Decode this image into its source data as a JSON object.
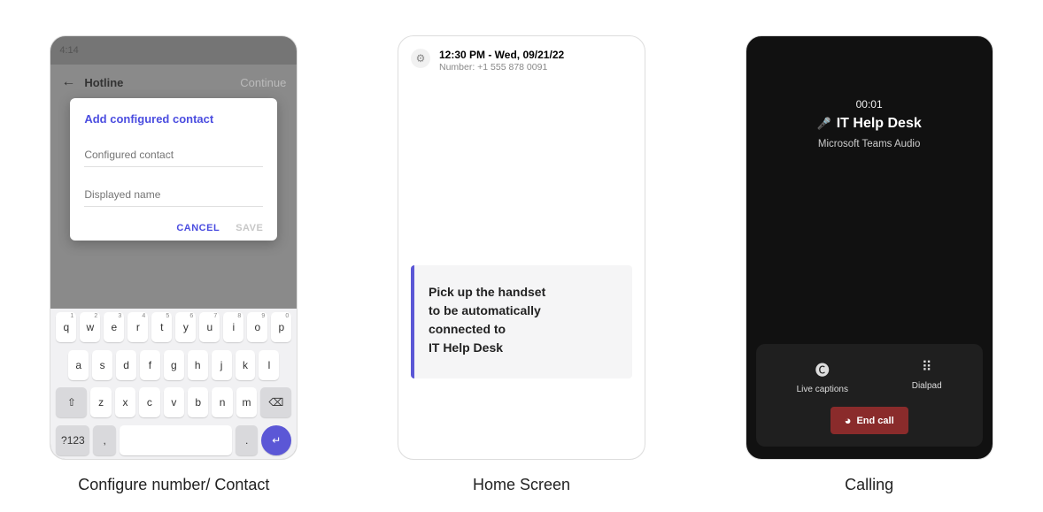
{
  "captions": {
    "one": "Configure number/ Contact",
    "two": "Home Screen",
    "three": "Calling"
  },
  "phone1": {
    "status_time": "4:14",
    "header_title": "Hotline",
    "header_continue": "Continue",
    "dialog_title": "Add configured contact",
    "field1_placeholder": "Configured contact",
    "field2_placeholder": "Displayed name",
    "cancel": "CANCEL",
    "save": "SAVE",
    "keyboard": {
      "row1": [
        "q",
        "w",
        "e",
        "r",
        "t",
        "y",
        "u",
        "i",
        "o",
        "p"
      ],
      "row1_sup": [
        "1",
        "2",
        "3",
        "4",
        "5",
        "6",
        "7",
        "8",
        "9",
        "0"
      ],
      "row2": [
        "a",
        "s",
        "d",
        "f",
        "g",
        "h",
        "j",
        "k",
        "l"
      ],
      "row3": [
        "z",
        "x",
        "c",
        "v",
        "b",
        "n",
        "m"
      ],
      "shift": "⇧",
      "backspace": "⌫",
      "numkey": "?123",
      "comma": ",",
      "period": ".",
      "enter": "↵"
    }
  },
  "phone2": {
    "time_date": "12:30 PM - Wed, 09/21/22",
    "number_label": "Number: +1 555 878 0091",
    "card_line1": "Pick up the handset",
    "card_line2": "to be automatically",
    "card_line3": "connected to",
    "card_line4": "IT Help Desk"
  },
  "phone3": {
    "timer": "00:01",
    "title": "IT Help Desk",
    "subtitle": "Microsoft Teams Audio",
    "live_captions": "Live captions",
    "dialpad": "Dialpad",
    "end_call": "End call"
  }
}
